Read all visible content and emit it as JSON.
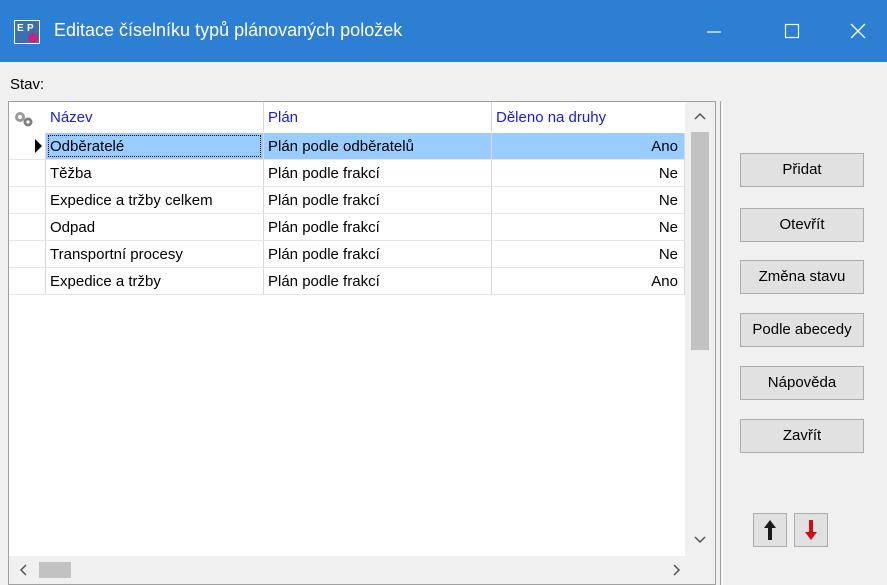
{
  "window": {
    "title": "Editace číselníku typů plánovaných položek",
    "app_icon": "ep-app-icon",
    "controls": [
      "minimize-icon",
      "maximize-icon",
      "close-icon"
    ]
  },
  "status": {
    "label": "Stav:"
  },
  "grid": {
    "columns": [
      "Název",
      "Plán",
      "Děleno na druhy"
    ],
    "rows": [
      {
        "name": "Odběratelé",
        "plan": "Plán podle odběratelů",
        "divided": "Ano",
        "selected": true
      },
      {
        "name": "Těžba",
        "plan": "Plán podle frakcí",
        "divided": "Ne"
      },
      {
        "name": "Expedice a tržby celkem",
        "plan": "Plán podle frakcí",
        "divided": "Ne"
      },
      {
        "name": "Odpad",
        "plan": "Plán podle frakcí",
        "divided": "Ne"
      },
      {
        "name": "Transportní procesy",
        "plan": "Plán podle frakcí",
        "divided": "Ne"
      },
      {
        "name": "Expedice a tržby",
        "plan": "Plán podle frakcí",
        "divided": "Ano"
      }
    ],
    "selection_color": "#99ccff",
    "header_text_color": "#1a1ae6"
  },
  "buttons": {
    "add": "Přidat",
    "open": "Otevřít",
    "change_state": "Změna stavu",
    "alphabetical": "Podle abecedy",
    "help": "Nápověda",
    "close": "Zavřít",
    "move_up_icon": "arrow-up-icon",
    "move_down_icon": "arrow-down-icon"
  },
  "colors": {
    "titlebar": "#2d7fd3",
    "down_arrow": "#d01010"
  }
}
